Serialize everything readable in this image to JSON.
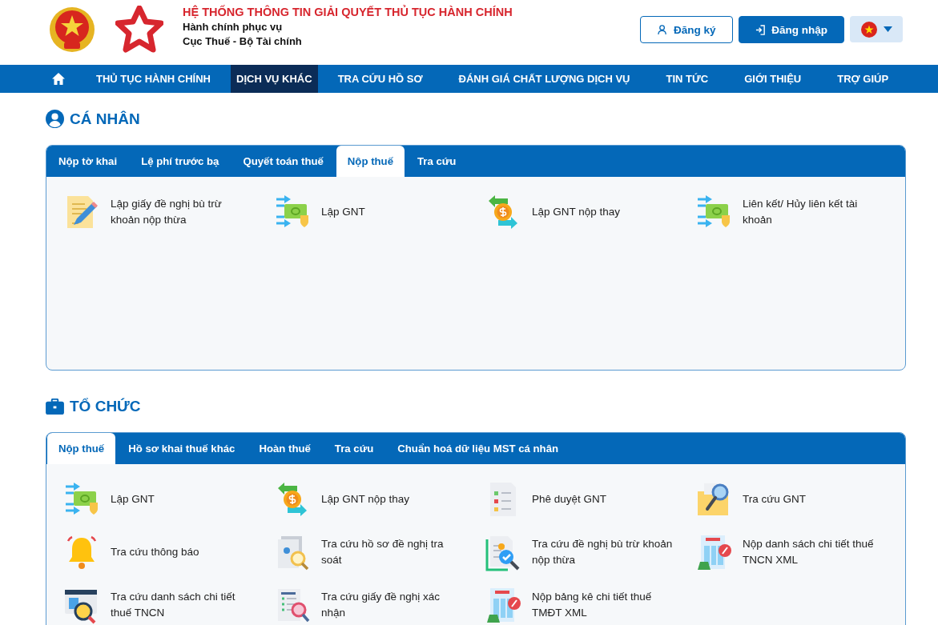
{
  "header": {
    "title": "HỆ THỐNG THÔNG TIN GIẢI QUYẾT THỦ TỤC HÀNH CHÍNH",
    "subtitle": "Hành chính phục vụ",
    "agency": "Cục Thuế - Bộ Tài chính",
    "register": "Đăng ký",
    "login": "Đăng nhập"
  },
  "nav": [
    {
      "label": "THỦ TỤC HÀNH CHÍNH",
      "selected": false
    },
    {
      "label": "DỊCH VỤ KHÁC",
      "selected": true
    },
    {
      "label": "TRA CỨU HỒ SƠ",
      "selected": false
    },
    {
      "label": "ĐÁNH GIÁ CHẤT LƯỢNG DỊCH VỤ",
      "selected": false
    },
    {
      "label": "TIN TỨC",
      "selected": false
    },
    {
      "label": "GIỚI THIỆU",
      "selected": false
    },
    {
      "label": "TRỢ GIÚP",
      "selected": false
    }
  ],
  "sections": [
    {
      "title": "CÁ NHÂN",
      "tabs": [
        {
          "label": "Nộp tờ khai",
          "selected": false
        },
        {
          "label": "Lệ phí trước bạ",
          "selected": false
        },
        {
          "label": "Quyết toán thuế",
          "selected": false
        },
        {
          "label": "Nộp thuế",
          "selected": true
        },
        {
          "label": "Tra cứu",
          "selected": false
        }
      ],
      "items": [
        "Lập giấy đề nghị bù trừ khoản nộp thừa",
        "Lập GNT",
        "Lập GNT nộp thay",
        "Liên kết/ Hủy liên kết tài khoản"
      ]
    },
    {
      "title": "TỔ CHỨC",
      "tabs": [
        {
          "label": "Nộp thuế",
          "selected": true
        },
        {
          "label": "Hồ sơ khai thuế khác",
          "selected": false
        },
        {
          "label": "Hoàn thuế",
          "selected": false
        },
        {
          "label": "Tra cứu",
          "selected": false
        },
        {
          "label": "Chuẩn hoá dữ liệu MST cá nhân",
          "selected": false
        }
      ],
      "items": [
        "Lập GNT",
        "Lập GNT nộp thay",
        "Phê duyệt GNT",
        "Tra cứu GNT",
        "Tra cứu thông báo",
        "Tra cứu hồ sơ đề nghị tra soát",
        "Tra cứu đề nghị bù trừ khoản nộp thừa",
        "Nộp danh sách chi tiết thuế TNCN XML",
        "Tra cứu danh sách chi tiết thuế TNCN",
        "Tra cứu giấy đề nghị xác nhận",
        "Nộp bảng kê chi tiết thuế TMĐT XML"
      ]
    }
  ]
}
